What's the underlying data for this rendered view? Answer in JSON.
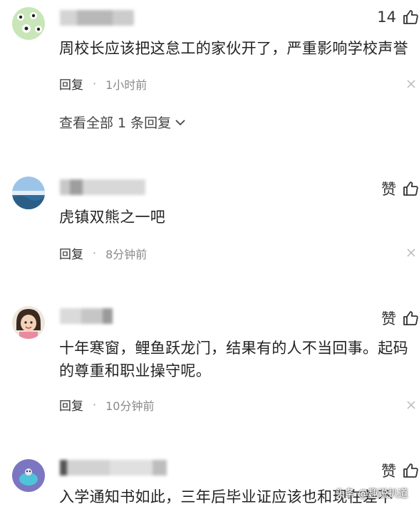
{
  "comments": [
    {
      "likes": "14",
      "text": "周校长应该把这怠工的家伙开了，严重影响学校声誉",
      "reply_label": "回复",
      "separator": "·",
      "time": "1小时前",
      "view_all": "查看全部 1 条回复"
    },
    {
      "likes": "赞",
      "text": "虎镇双熊之一吧",
      "reply_label": "回复",
      "separator": "·",
      "time": "8分钟前"
    },
    {
      "likes": "赞",
      "text_line1": "十年寒窗，鲤鱼跃龙门，结果有的人不当回事。起码",
      "text_line2": "的尊重和职业操守呢。",
      "reply_label": "回复",
      "separator": "·",
      "time": "10分钟前"
    },
    {
      "likes": "赞",
      "text": "入学通知书如此，三年后毕业证应该也和现在差不"
    }
  ],
  "watermark": "头条 @趣说扒道",
  "colors": {
    "text": "#222222",
    "meta": "#8a8a8a",
    "background": "#ffffff"
  },
  "icons": [
    "thumb-up-icon",
    "close-icon",
    "chevron-down-icon"
  ]
}
